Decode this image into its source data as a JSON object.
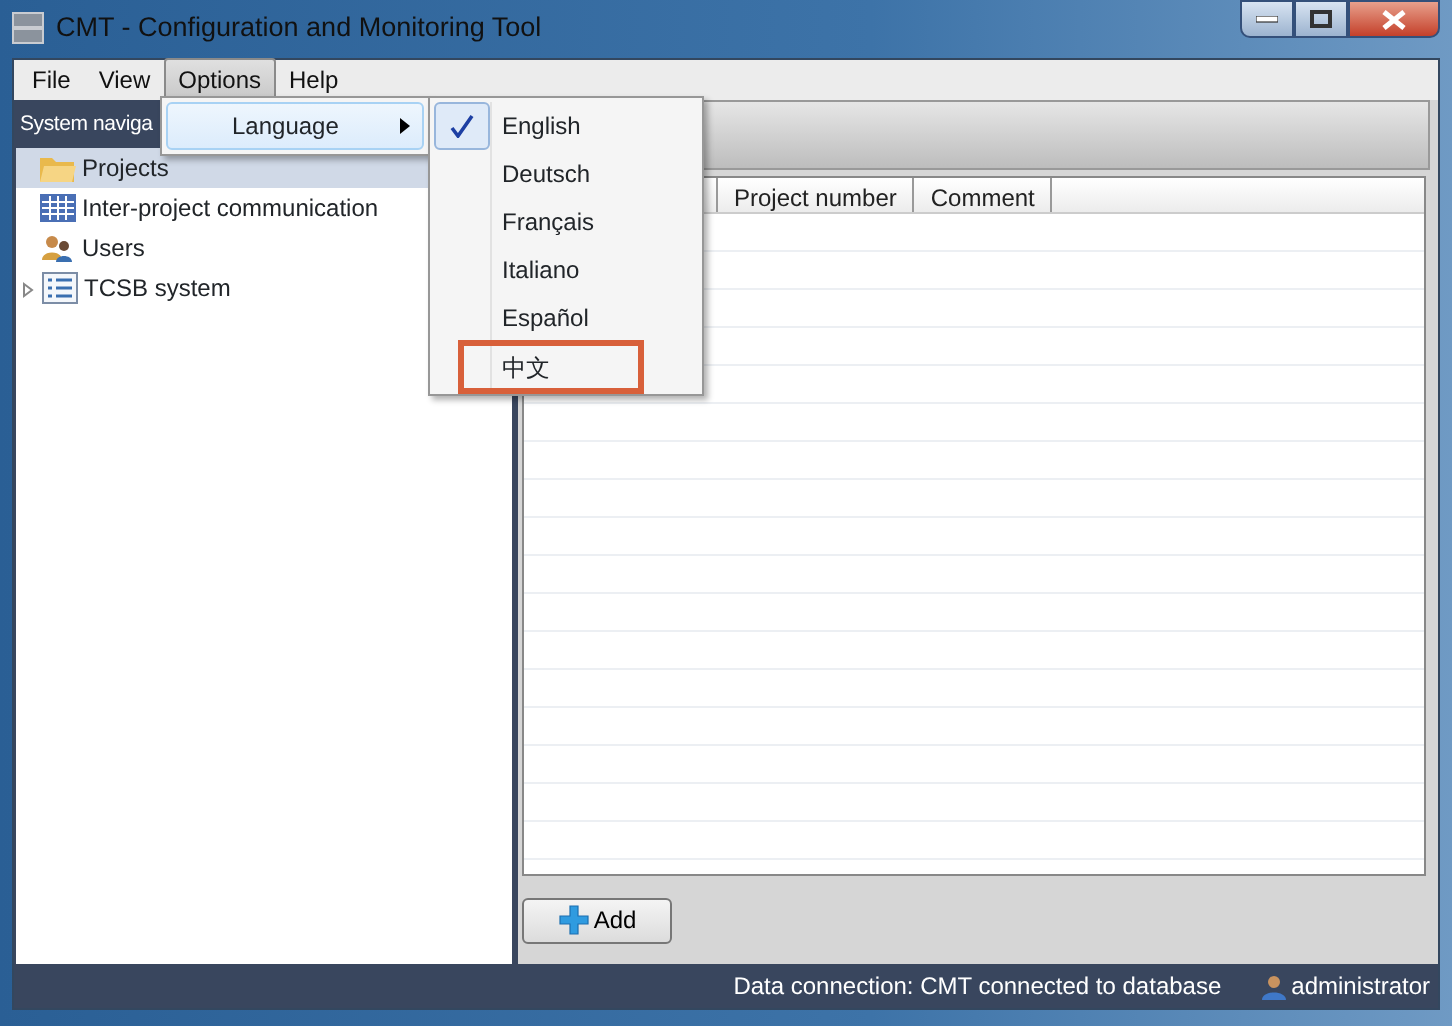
{
  "window": {
    "title": "CMT - Configuration and Monitoring Tool"
  },
  "menu": [
    {
      "label": "File",
      "selected": false
    },
    {
      "label": "View",
      "selected": false
    },
    {
      "label": "Options",
      "selected": true
    },
    {
      "label": "Help",
      "selected": false
    }
  ],
  "options_menu": [
    {
      "label": "Language",
      "selected": true,
      "submenu": true
    }
  ],
  "language_menu": [
    {
      "label": "English",
      "checked": true,
      "outlined": false
    },
    {
      "label": "Deutsch",
      "checked": false,
      "outlined": false
    },
    {
      "label": "Français",
      "checked": false,
      "outlined": false
    },
    {
      "label": "Italiano",
      "checked": false,
      "outlined": false
    },
    {
      "label": "Español",
      "checked": false,
      "outlined": false
    },
    {
      "label": "中文",
      "checked": false,
      "outlined": true
    }
  ],
  "sidebar": {
    "header": "System naviga",
    "items": [
      {
        "label": "Projects",
        "selected": true
      },
      {
        "label": "Inter-project communication",
        "selected": false
      },
      {
        "label": "Users",
        "selected": false
      },
      {
        "label": "TCSB system",
        "selected": false,
        "expanded": false
      }
    ]
  },
  "table": {
    "columns": [
      "Project number",
      "Comment"
    ]
  },
  "buttons": [
    "Add"
  ],
  "status_bar": {
    "connection": "Data connection: CMT connected to database",
    "user": "administrator"
  }
}
